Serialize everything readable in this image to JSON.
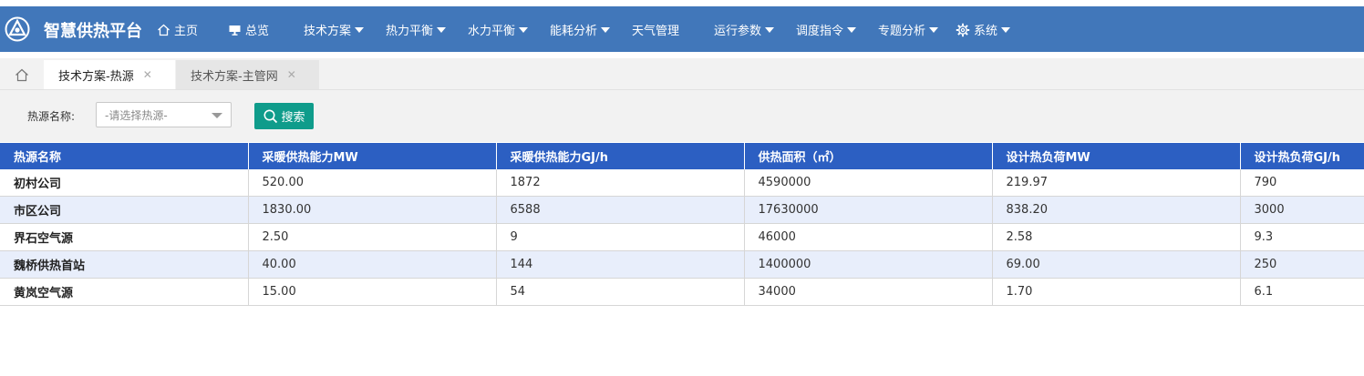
{
  "brand": {
    "title": "智慧供热平台"
  },
  "nav": [
    {
      "label": "主页",
      "icon": "home-icon"
    },
    {
      "label": "总览",
      "icon": "monitor-icon"
    },
    {
      "label": "技术方案",
      "dropdown": true
    },
    {
      "label": "热力平衡",
      "dropdown": true
    },
    {
      "label": "水力平衡",
      "dropdown": true
    },
    {
      "label": "能耗分析",
      "dropdown": true
    },
    {
      "label": "天气管理"
    },
    {
      "label": "运行参数",
      "dropdown": true
    },
    {
      "label": "调度指令",
      "dropdown": true
    },
    {
      "label": "专题分析",
      "dropdown": true
    },
    {
      "label": "系统",
      "icon": "gear-icon",
      "dropdown": true
    }
  ],
  "tabs": [
    {
      "label": "技术方案-热源",
      "active": true
    },
    {
      "label": "技术方案-主管网",
      "active": false
    }
  ],
  "filter": {
    "label": "热源名称:",
    "select_placeholder": "-请选择热源-",
    "search_label": "搜索"
  },
  "table": {
    "columns": [
      "热源名称",
      "采暖供热能力MW",
      "采暖供热能力GJ/h",
      "供热面积（㎡）",
      "设计热负荷MW",
      "设计热负荷GJ/h"
    ],
    "rows": [
      [
        "初村公司",
        "520.00",
        "1872",
        "4590000",
        "219.97",
        "790"
      ],
      [
        "市区公司",
        "1830.00",
        "6588",
        "17630000",
        "838.20",
        "3000"
      ],
      [
        "界石空气源",
        "2.50",
        "9",
        "46000",
        "2.58",
        "9.3"
      ],
      [
        "魏桥供热首站",
        "40.00",
        "144",
        "1400000",
        "69.00",
        "250"
      ],
      [
        "黄岚空气源",
        "15.00",
        "54",
        "34000",
        "1.70",
        "6.1"
      ]
    ]
  },
  "colors": {
    "topbar": "#4177ba",
    "table_header": "#2c5fc2",
    "row_alt": "#e8eefb",
    "search_button": "#0f9c8b"
  }
}
